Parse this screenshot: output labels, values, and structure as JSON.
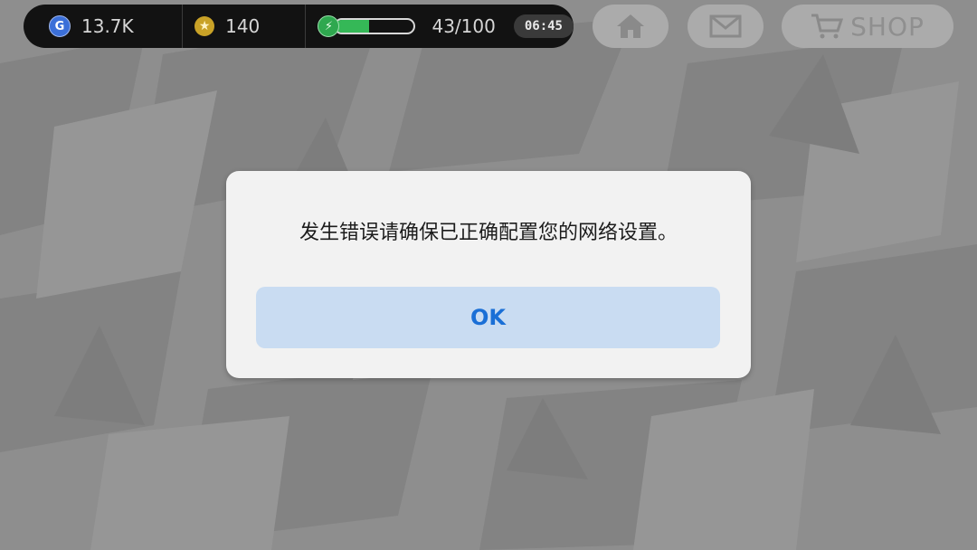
{
  "hud": {
    "currency_g": "13.7K",
    "currency_g_icon": "g-coin-icon",
    "currency_star": "140",
    "currency_star_icon": "star-coin-icon",
    "energy_text": "43/100",
    "energy_fraction": 0.43,
    "energy_icon": "lightning-icon",
    "timer": "06:45"
  },
  "nav": {
    "home_icon": "home-icon",
    "mail_icon": "mail-icon",
    "shop_icon": "cart-icon",
    "shop_label": "SHOP"
  },
  "dialog": {
    "message": "发生错误请确保已正确配置您的网络设置。",
    "ok_label": "OK"
  },
  "colors": {
    "ok_text": "#1a6fd6",
    "ok_background": "#c9dcf2",
    "energy_fill": "#35b857",
    "overlay_background": "#8c8c8c"
  }
}
